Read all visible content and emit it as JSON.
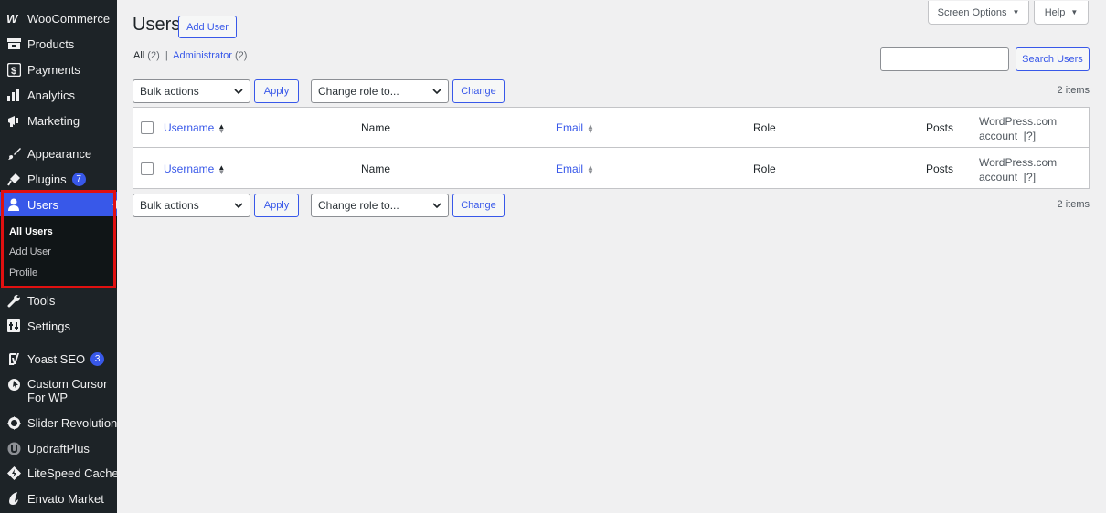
{
  "sidebar": {
    "items": [
      {
        "label": "WooCommerce",
        "icon": "woo-icon"
      },
      {
        "label": "Products",
        "icon": "archive-icon"
      },
      {
        "label": "Payments",
        "icon": "payments-icon"
      },
      {
        "label": "Analytics",
        "icon": "analytics-icon"
      },
      {
        "label": "Marketing",
        "icon": "megaphone-icon"
      },
      {
        "label": "Appearance",
        "icon": "paintbrush-icon"
      },
      {
        "label": "Plugins",
        "icon": "plugin-icon",
        "badge": "7"
      },
      {
        "label": "Users",
        "icon": "users-icon",
        "active": true
      },
      {
        "label": "Tools",
        "icon": "wrench-icon"
      },
      {
        "label": "Settings",
        "icon": "settings-icon"
      },
      {
        "label": "Yoast SEO",
        "icon": "yoast-icon",
        "badge": "3"
      },
      {
        "label": "Custom Cursor For WP",
        "icon": "cursor-plugin-icon"
      },
      {
        "label": "Slider Revolution",
        "icon": "slider-revolution-icon"
      },
      {
        "label": "UpdraftPlus",
        "icon": "updraftplus-icon"
      },
      {
        "label": "LiteSpeed Cache",
        "icon": "litespeed-icon"
      },
      {
        "label": "Envato Market",
        "icon": "envato-icon"
      }
    ],
    "submenu": [
      {
        "label": "All Users",
        "current": true
      },
      {
        "label": "Add User"
      },
      {
        "label": "Profile"
      }
    ]
  },
  "header": {
    "screen_options": "Screen Options",
    "help": "Help"
  },
  "main": {
    "title": "Users",
    "add_user": "Add User",
    "filters": {
      "all_label": "All",
      "all_count": "(2)",
      "separator": "|",
      "admin_label": "Administrator",
      "admin_count": "(2)"
    },
    "search_button": "Search Users",
    "search_value": "",
    "bulk_actions": "Bulk actions",
    "apply": "Apply",
    "change_role": "Change role to...",
    "change": "Change",
    "items_count": "2 items"
  },
  "table": {
    "columns": {
      "username": "Username",
      "name": "Name",
      "email": "Email",
      "role": "Role",
      "posts": "Posts",
      "wpcom_line1": "WordPress.com",
      "wpcom_line2": "account  [?]"
    }
  },
  "colors": {
    "sidebar_bg": "#1d2327",
    "accent": "#3858e9",
    "highlight": "#e01010"
  }
}
